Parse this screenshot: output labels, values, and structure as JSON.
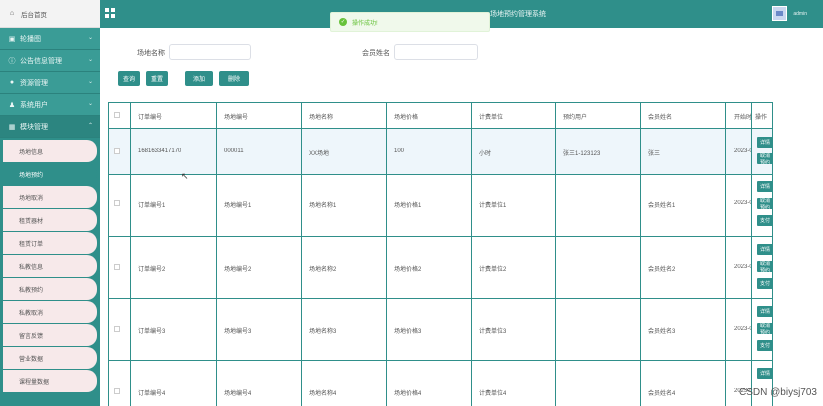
{
  "header": {
    "title": "场地预约管理系统",
    "user": "admin"
  },
  "toast": {
    "message": "操作成功!"
  },
  "sidebar": {
    "home": "后台首页",
    "menus": [
      {
        "label": "轮播图"
      },
      {
        "label": "公告信息管理"
      },
      {
        "label": "资源管理"
      },
      {
        "label": "系统用户"
      },
      {
        "label": "模块管理"
      }
    ],
    "sub_items": [
      {
        "label": "场地信息",
        "active": false
      },
      {
        "label": "场地预约",
        "active": true
      },
      {
        "label": "场地取消",
        "active": false
      },
      {
        "label": "租赁器材",
        "active": false
      },
      {
        "label": "租赁订单",
        "active": false
      },
      {
        "label": "私教信息",
        "active": false
      },
      {
        "label": "私教预约",
        "active": false
      },
      {
        "label": "私教取消",
        "active": false
      },
      {
        "label": "留言反馈",
        "active": false
      },
      {
        "label": "营业数据",
        "active": false
      },
      {
        "label": "课程量数据",
        "active": false
      }
    ]
  },
  "search": {
    "field1_label": "场地名称",
    "field1_value": "",
    "field2_label": "会员姓名",
    "field2_value": ""
  },
  "toolbar": {
    "query": "查询",
    "reset": "重置",
    "add": "添加",
    "delete": "删除"
  },
  "table": {
    "columns": [
      "订单编号",
      "场地编号",
      "场地名称",
      "场地价格",
      "计费单位",
      "预约用户",
      "会员姓名",
      "开始时间",
      "操作"
    ],
    "rows": [
      {
        "order_no": "1681633417170",
        "venue_no": "000011",
        "venue_name": "XX场地",
        "price": "100",
        "unit": "小时",
        "user": "张三1-123123",
        "member": "张三",
        "start": "2023-0",
        "actions": [
          "详情",
          "取消预约"
        ]
      },
      {
        "order_no": "订单编号1",
        "venue_no": "场地编号1",
        "venue_name": "场地名称1",
        "price": "场地价格1",
        "unit": "计费单位1",
        "user": "",
        "member": "会员姓名1",
        "start": "2023-0",
        "actions": [
          "详情",
          "取消预约",
          "支付"
        ]
      },
      {
        "order_no": "订单编号2",
        "venue_no": "场地编号2",
        "venue_name": "场地名称2",
        "price": "场地价格2",
        "unit": "计费单位2",
        "user": "",
        "member": "会员姓名2",
        "start": "2023-0",
        "actions": [
          "详情",
          "取消预约",
          "支付"
        ]
      },
      {
        "order_no": "订单编号3",
        "venue_no": "场地编号3",
        "venue_name": "场地名称3",
        "price": "场地价格3",
        "unit": "计费单位3",
        "user": "",
        "member": "会员姓名3",
        "start": "2023-0",
        "actions": [
          "详情",
          "取消预约",
          "支付"
        ]
      },
      {
        "order_no": "订单编号4",
        "venue_no": "场地编号4",
        "venue_name": "场地名称4",
        "price": "场地价格4",
        "unit": "计费单位4",
        "user": "",
        "member": "会员姓名4",
        "start": "2023-0",
        "actions": [
          "详情"
        ]
      }
    ]
  },
  "watermark": "CSDN @biysj703",
  "colors": {
    "primary": "#2f8f8a",
    "toast_bg": "#f0f9eb",
    "toast_text": "#67c23a"
  },
  "icons": {
    "home": "home-icon",
    "grid": "grid-icon"
  }
}
